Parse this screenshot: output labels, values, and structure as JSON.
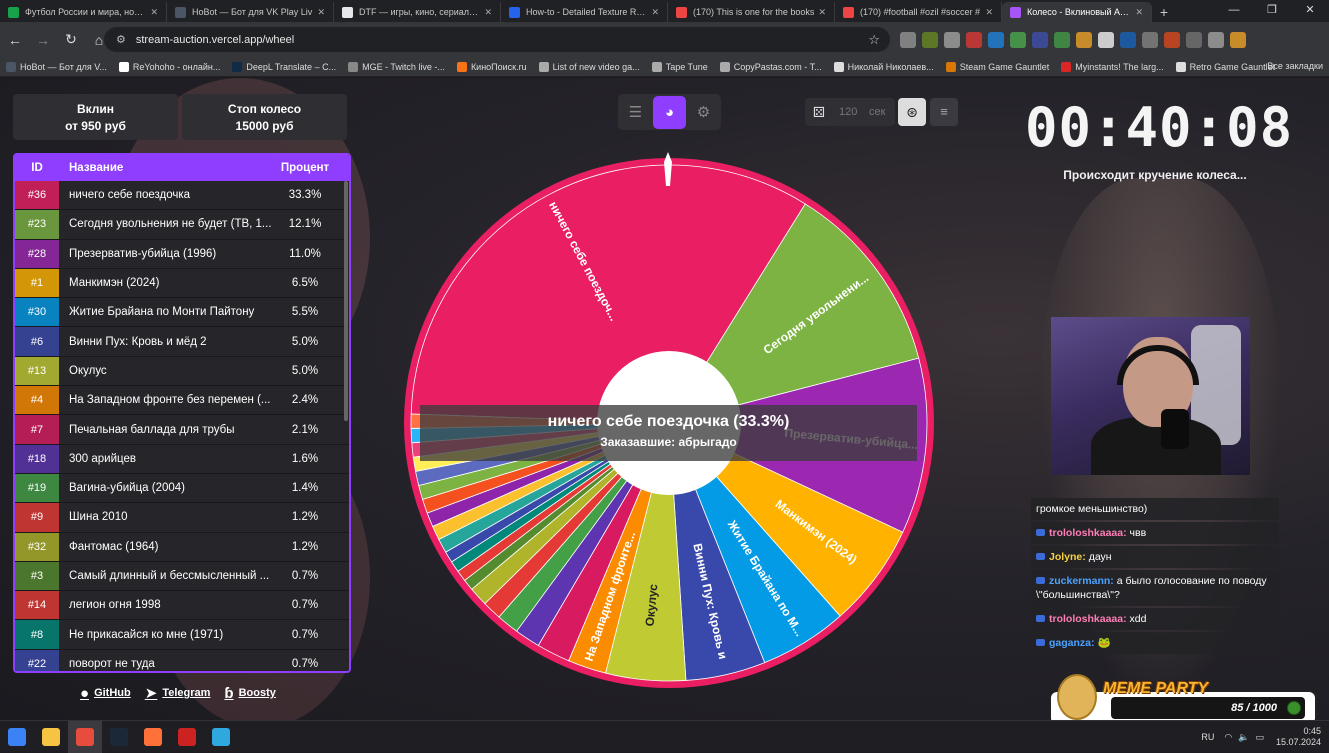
{
  "browser": {
    "tabs": [
      {
        "label": "Футбол России и мира, новост",
        "color": "#16a34a"
      },
      {
        "label": "HoBot — Бот для VK Play Liv",
        "color": "#4b5563"
      },
      {
        "label": "DTF — игры, кино, сериалы, р",
        "color": "#e5e7eb"
      },
      {
        "label": "How-to - Detailed Texture Repl",
        "color": "#2563eb"
      },
      {
        "label": "(170) This is one for the books",
        "color": "#ef4444"
      },
      {
        "label": "(170) #football #ozil #soccer #",
        "color": "#ef4444"
      },
      {
        "label": "Колесо - Вклиновый Аукцион",
        "color": "#a855f7"
      }
    ],
    "new_tab": "+",
    "url": "stream-auction.vercel.app/wheel",
    "window_controls": [
      "—",
      "❐",
      "✕"
    ],
    "nav_icons": [
      "←",
      "→",
      "↻",
      "⌂"
    ],
    "bookmarks": [
      {
        "label": "HoBot — Бот для V...",
        "color": "#4b5563"
      },
      {
        "label": "ReYohoho - онлайн...",
        "color": "#ffffff"
      },
      {
        "label": "DeepL Translate – С...",
        "color": "#0f2b46"
      },
      {
        "label": "MGE - Twitch live -...",
        "color": "#888888"
      },
      {
        "label": "КиноПоиск.ru",
        "color": "#f97316"
      },
      {
        "label": "List of new video ga...",
        "color": "#aaaaaa"
      },
      {
        "label": "Tape Tune",
        "color": "#aaaaaa"
      },
      {
        "label": "CopyPastas.com - T...",
        "color": "#aaaaaa"
      },
      {
        "label": "Николай Николаев...",
        "color": "#dddddd"
      },
      {
        "label": "Steam Game Gauntlet",
        "color": "#d97706"
      },
      {
        "label": "Myinstants! The larg...",
        "color": "#dc2626"
      },
      {
        "label": "Retro Game Gauntlet",
        "color": "#dddddd"
      }
    ],
    "all_bookmarks": "Все закладки"
  },
  "info_cards": [
    {
      "line1": "Вклин",
      "line2": "от 950 руб"
    },
    {
      "line1": "Стоп колесо",
      "line2": "15000 руб"
    }
  ],
  "table": {
    "headers": {
      "id": "ID",
      "name": "Название",
      "percent": "Процент"
    },
    "rows": [
      {
        "id": "#36",
        "name": "ничего себе поездочка",
        "pct": "33.3%",
        "color": "#e91e63"
      },
      {
        "id": "#23",
        "name": "Сегодня увольнения не будет (ТВ, 1...",
        "pct": "12.1%",
        "color": "#7cb342"
      },
      {
        "id": "#28",
        "name": "Презерватив-убийца (1996)",
        "pct": "11.0%",
        "color": "#9c27b0"
      },
      {
        "id": "#1",
        "name": "Манкимэн (2024)",
        "pct": "6.5%",
        "color": "#ffb300"
      },
      {
        "id": "#30",
        "name": "Житие Брайана по Монти Пайтону",
        "pct": "5.5%",
        "color": "#039be5"
      },
      {
        "id": "#6",
        "name": "Винни Пух: Кровь и мёд 2",
        "pct": "5.0%",
        "color": "#3949ab"
      },
      {
        "id": "#13",
        "name": "Окулус",
        "pct": "5.0%",
        "color": "#c0ca33"
      },
      {
        "id": "#4",
        "name": "На Западном фронте без перемен (...",
        "pct": "2.4%",
        "color": "#fb8c00"
      },
      {
        "id": "#7",
        "name": "Печальная баллада для трубы",
        "pct": "2.1%",
        "color": "#d81b60"
      },
      {
        "id": "#18",
        "name": "300 арийцев",
        "pct": "1.6%",
        "color": "#5e35b1"
      },
      {
        "id": "#19",
        "name": "Вагина-убийца (2004)",
        "pct": "1.4%",
        "color": "#43a047"
      },
      {
        "id": "#9",
        "name": "Шина 2010",
        "pct": "1.2%",
        "color": "#e53935"
      },
      {
        "id": "#32",
        "name": "Фантомас (1964)",
        "pct": "1.2%",
        "color": "#afb42b"
      },
      {
        "id": "#3",
        "name": "Самый длинный и бессмысленный ...",
        "pct": "0.7%",
        "color": "#558b2f"
      },
      {
        "id": "#14",
        "name": "легион огня 1998",
        "pct": "0.7%",
        "color": "#e53935"
      },
      {
        "id": "#8",
        "name": "Не прикасайся ко мне (1971)",
        "pct": "0.7%",
        "color": "#00897b"
      },
      {
        "id": "#22",
        "name": "поворот не туда",
        "pct": "0.7%",
        "color": "#3949ab"
      }
    ]
  },
  "links": [
    {
      "label": "GitHub",
      "icon": "github-icon"
    },
    {
      "label": "Telegram",
      "icon": "telegram-icon"
    },
    {
      "label": "Boosty",
      "icon": "boosty-icon"
    }
  ],
  "controls": {
    "timer_seconds": "120",
    "timer_unit": "сек"
  },
  "wheel": {
    "accent_color": "#8f3dff",
    "ring_color": "#e91e63",
    "labels": [
      "ничего себе поездоч...",
      "Сегодня увольнени...",
      "Презерватив-убийца...",
      "Манкимэн (2024)",
      "Житие Брайана по М...",
      "Винни Пух: Кровь и",
      "Окулус",
      "На Западном фронте..."
    ],
    "winner_text": "ничего себе поездочка (33.3%)",
    "ordered_by": "Заказавшие: абрыгадо"
  },
  "stream": {
    "timer": "00:40:08",
    "status": "Происходит кручение колеса...",
    "chat": [
      {
        "user": "",
        "text": "громкое меньшинство)",
        "color": "#ffffff"
      },
      {
        "user": "trololoshkaaaa:",
        "text": "чвв",
        "color": "#ff7eb6"
      },
      {
        "user": "Jolyne:",
        "text": "даун",
        "color": "#f5d142"
      },
      {
        "user": "zuckermann:",
        "text": "а было голосование по поводу \\\"большинства\\\"?",
        "color": "#4aa3ff"
      },
      {
        "user": "trololoshkaaaa:",
        "text": "xdd",
        "color": "#ff7eb6"
      },
      {
        "user": "gaganza:",
        "text": "🐸",
        "color": "#4aa3ff"
      }
    ],
    "meme_party": {
      "title": "MEME PARTY",
      "progress": "85 / 1000"
    }
  },
  "taskbar": {
    "lang": "RU",
    "time": "0:45",
    "date": "15.07.2024",
    "apps": [
      {
        "name": "windows-icon",
        "color": "#3b82f6"
      },
      {
        "name": "explorer-icon",
        "color": "#f6c343"
      },
      {
        "name": "chrome-icon",
        "color": "#e74c3c"
      },
      {
        "name": "steam-icon",
        "color": "#1b2838"
      },
      {
        "name": "firefox-icon",
        "color": "#ff7139"
      },
      {
        "name": "obs-icon",
        "color": "#cc2222"
      },
      {
        "name": "chat-app-icon",
        "color": "#2fa8e0"
      }
    ]
  }
}
